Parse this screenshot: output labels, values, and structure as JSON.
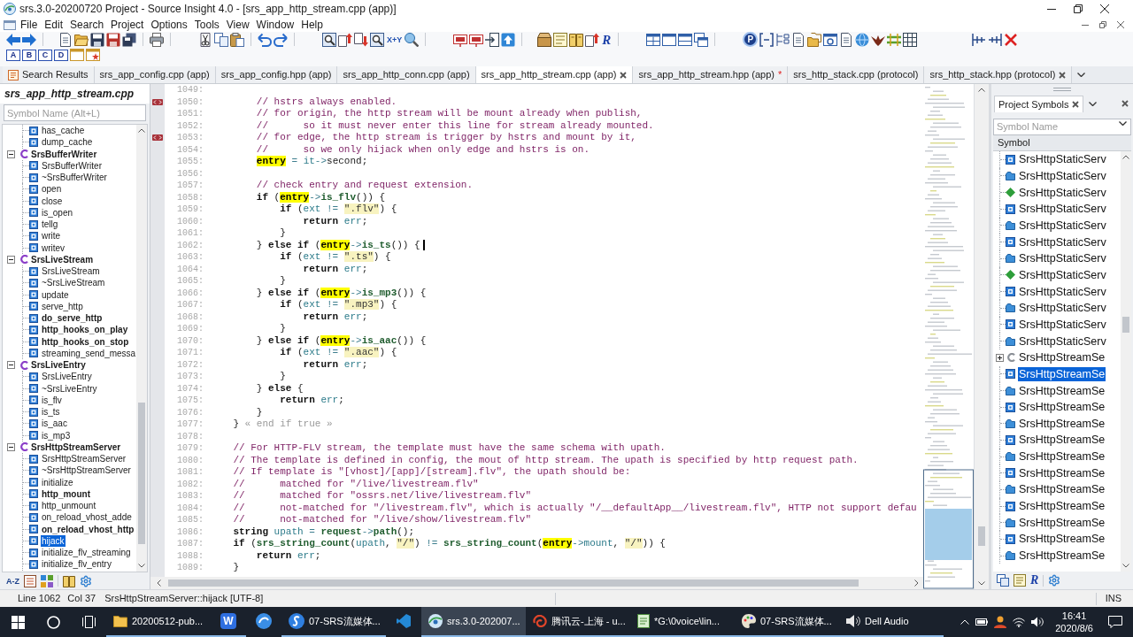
{
  "window": {
    "title": "srs.3.0-20200720 Project - Source Insight 4.0 - [srs_app_http_stream.cpp (app)]"
  },
  "menu": [
    "File",
    "Edit",
    "Search",
    "Project",
    "Options",
    "Tools",
    "View",
    "Window",
    "Help"
  ],
  "toolbar": {
    "icon_labels": [
      {
        "kind": "letters",
        "label": "X+Y"
      },
      {
        "kind": "script",
        "label": "R"
      },
      {
        "kind": "badge",
        "label": "P"
      }
    ],
    "bookmark_keys": [
      "A",
      "B",
      "C",
      "D"
    ]
  },
  "tabs": [
    {
      "label": "Search Results",
      "kind": "results",
      "selected": false,
      "closable": false
    },
    {
      "label": "srs_app_config.cpp (app)",
      "kind": "file",
      "selected": false,
      "closable": false
    },
    {
      "label": "srs_app_config.hpp (app)",
      "kind": "file",
      "selected": false,
      "closable": false
    },
    {
      "label": "srs_app_http_conn.cpp (app)",
      "kind": "file",
      "selected": false,
      "closable": false
    },
    {
      "label": "srs_app_http_stream.cpp (app)",
      "kind": "file",
      "selected": true,
      "closable": true
    },
    {
      "label": "srs_app_http_stream.hpp (app)",
      "kind": "file",
      "selected": false,
      "closable": false,
      "mark": "*"
    },
    {
      "label": "srs_http_stack.cpp (protocol)",
      "kind": "file",
      "selected": false,
      "closable": false
    },
    {
      "label": "srs_http_stack.hpp (protocol)",
      "kind": "file",
      "selected": false,
      "closable": true
    }
  ],
  "symbol_panel": {
    "title": "srs_app_http_stream.cpp",
    "search_placeholder": "Symbol Name (Alt+L)",
    "sort_label": "A-Z",
    "tree": [
      {
        "kind": "group",
        "children": [
          {
            "label": "has_cache",
            "kind": "method",
            "bold": false,
            "selected": false
          },
          {
            "label": "dump_cache",
            "kind": "method",
            "bold": false,
            "selected": false
          }
        ]
      },
      {
        "label": "SrsBufferWriter",
        "kind": "class",
        "bold": true,
        "selected": false,
        "expanded": true,
        "children": [
          {
            "label": "SrsBufferWriter",
            "kind": "method",
            "bold": false,
            "selected": false
          },
          {
            "label": "~SrsBufferWriter",
            "kind": "method",
            "bold": false,
            "selected": false
          },
          {
            "label": "open",
            "kind": "method",
            "bold": false,
            "selected": false
          },
          {
            "label": "close",
            "kind": "method",
            "bold": false,
            "selected": false
          },
          {
            "label": "is_open",
            "kind": "method",
            "bold": false,
            "selected": false
          },
          {
            "label": "tellg",
            "kind": "method",
            "bold": false,
            "selected": false
          },
          {
            "label": "write",
            "kind": "method",
            "bold": false,
            "selected": false
          },
          {
            "label": "writev",
            "kind": "method",
            "bold": false,
            "selected": false
          }
        ]
      },
      {
        "label": "SrsLiveStream",
        "kind": "class",
        "bold": true,
        "selected": false,
        "expanded": true,
        "children": [
          {
            "label": "SrsLiveStream",
            "kind": "method",
            "bold": false,
            "selected": false
          },
          {
            "label": "~SrsLiveStream",
            "kind": "method",
            "bold": false,
            "selected": false
          },
          {
            "label": "update",
            "kind": "method",
            "bold": false,
            "selected": false
          },
          {
            "label": "serve_http",
            "kind": "method",
            "bold": false,
            "selected": false
          },
          {
            "label": "do_serve_http",
            "kind": "method",
            "bold": true,
            "selected": false
          },
          {
            "label": "http_hooks_on_play",
            "kind": "method",
            "bold": true,
            "selected": false
          },
          {
            "label": "http_hooks_on_stop",
            "kind": "method",
            "bold": true,
            "selected": false
          },
          {
            "label": "streaming_send_messa",
            "kind": "method",
            "bold": false,
            "selected": false
          }
        ]
      },
      {
        "label": "SrsLiveEntry",
        "kind": "class",
        "bold": true,
        "selected": false,
        "expanded": true,
        "children": [
          {
            "label": "SrsLiveEntry",
            "kind": "method",
            "bold": false,
            "selected": false
          },
          {
            "label": "~SrsLiveEntry",
            "kind": "method",
            "bold": false,
            "selected": false
          },
          {
            "label": "is_flv",
            "kind": "method",
            "bold": false,
            "selected": false
          },
          {
            "label": "is_ts",
            "kind": "method",
            "bold": false,
            "selected": false
          },
          {
            "label": "is_aac",
            "kind": "method",
            "bold": false,
            "selected": false
          },
          {
            "label": "is_mp3",
            "kind": "method",
            "bold": false,
            "selected": false
          }
        ]
      },
      {
        "label": "SrsHttpStreamServer",
        "kind": "class",
        "bold": true,
        "selected": false,
        "expanded": true,
        "children": [
          {
            "label": "SrsHttpStreamServer",
            "kind": "method",
            "bold": false,
            "selected": false
          },
          {
            "label": "~SrsHttpStreamServer",
            "kind": "method",
            "bold": false,
            "selected": false
          },
          {
            "label": "initialize",
            "kind": "method",
            "bold": false,
            "selected": false
          },
          {
            "label": "http_mount",
            "kind": "method",
            "bold": true,
            "selected": false
          },
          {
            "label": "http_unmount",
            "kind": "method",
            "bold": false,
            "selected": false
          },
          {
            "label": "on_reload_vhost_adde",
            "kind": "method",
            "bold": false,
            "selected": false
          },
          {
            "label": "on_reload_vhost_http",
            "kind": "method",
            "bold": true,
            "selected": false
          },
          {
            "label": "hijack",
            "kind": "method",
            "bold": false,
            "selected": true
          },
          {
            "label": "initialize_flv_streaming",
            "kind": "method",
            "bold": false,
            "selected": false
          },
          {
            "label": "initialize_flv_entry",
            "kind": "method",
            "bold": false,
            "selected": false
          }
        ]
      }
    ]
  },
  "editor": {
    "lines": [
      {
        "number": "1049:",
        "bookmark": false
      },
      {
        "number": "1050:",
        "bookmark": true,
        "tokens": [
          {
            "kind": "comment",
            "text": "        // hstrs always enabled."
          }
        ]
      },
      {
        "number": "1051:",
        "bookmark": false,
        "tokens": [
          {
            "kind": "comment",
            "text": "        // for origin, the http stream will be mount already when publish,"
          }
        ]
      },
      {
        "number": "1052:",
        "bookmark": false,
        "tokens": [
          {
            "kind": "comment",
            "text": "        //      so it must never enter this line for stream already mounted."
          }
        ]
      },
      {
        "number": "1053:",
        "bookmark": true,
        "tokens": [
          {
            "kind": "comment",
            "text": "        // for edge, the http stream is trigger by hstrs and mount by it,"
          }
        ]
      },
      {
        "number": "1054:",
        "bookmark": false,
        "tokens": [
          {
            "kind": "comment",
            "text": "        //      so we only hijack when only edge and hstrs is on."
          }
        ]
      },
      {
        "number": "1055:",
        "bookmark": false,
        "tokens": [
          {
            "kind": "match",
            "text": "        entry"
          },
          {
            "kind": "operator",
            "text": " = "
          },
          {
            "kind": "variable",
            "text": "it"
          },
          {
            "kind": "operator",
            "text": "->"
          },
          {
            "kind": "plain",
            "text": "second;"
          }
        ]
      },
      {
        "number": "1056:",
        "bookmark": false
      },
      {
        "number": "1057:",
        "bookmark": false,
        "tokens": [
          {
            "kind": "comment",
            "text": "        // check entry and request extension."
          }
        ]
      },
      {
        "number": "1058:",
        "bookmark": false,
        "tokens": [
          {
            "kind": "keyword",
            "text": "        if"
          },
          {
            "kind": "plain",
            "text": " ("
          },
          {
            "kind": "match",
            "text": "entry"
          },
          {
            "kind": "operator",
            "text": "->"
          },
          {
            "kind": "function",
            "text": "is_flv"
          },
          {
            "kind": "plain",
            "text": "()) {"
          }
        ]
      },
      {
        "number": "1059:",
        "bookmark": false,
        "tokens": [
          {
            "kind": "keyword",
            "text": "            if"
          },
          {
            "kind": "plain",
            "text": " ("
          },
          {
            "kind": "variable",
            "text": "ext"
          },
          {
            "kind": "operator",
            "text": " != "
          },
          {
            "kind": "string",
            "text": "\".flv\""
          },
          {
            "kind": "plain",
            "text": ") {"
          }
        ]
      },
      {
        "number": "1060:",
        "bookmark": false,
        "tokens": [
          {
            "kind": "keyword",
            "text": "                return "
          },
          {
            "kind": "variable",
            "text": "err"
          },
          {
            "kind": "plain",
            "text": ";"
          }
        ]
      },
      {
        "number": "1061:",
        "bookmark": false,
        "tokens": [
          {
            "kind": "plain",
            "text": "            }"
          }
        ]
      },
      {
        "number": "1062:",
        "bookmark": false,
        "tokens": [
          {
            "kind": "plain",
            "text": "        } "
          },
          {
            "kind": "keyword",
            "text": "else if"
          },
          {
            "kind": "plain",
            "text": " ("
          },
          {
            "kind": "match",
            "text": "entry"
          },
          {
            "kind": "operator",
            "text": "->"
          },
          {
            "kind": "function",
            "text": "is_ts"
          },
          {
            "kind": "plain",
            "text": "()) {"
          },
          {
            "kind": "caret"
          }
        ]
      },
      {
        "number": "1063:",
        "bookmark": false,
        "tokens": [
          {
            "kind": "keyword",
            "text": "            if"
          },
          {
            "kind": "plain",
            "text": " ("
          },
          {
            "kind": "variable",
            "text": "ext"
          },
          {
            "kind": "operator",
            "text": " != "
          },
          {
            "kind": "string",
            "text": "\".ts\""
          },
          {
            "kind": "plain",
            "text": ") {"
          }
        ]
      },
      {
        "number": "1064:",
        "bookmark": false,
        "tokens": [
          {
            "kind": "keyword",
            "text": "                return "
          },
          {
            "kind": "variable",
            "text": "err"
          },
          {
            "kind": "plain",
            "text": ";"
          }
        ]
      },
      {
        "number": "1065:",
        "bookmark": false,
        "tokens": [
          {
            "kind": "plain",
            "text": "            }"
          }
        ]
      },
      {
        "number": "1066:",
        "bookmark": false,
        "tokens": [
          {
            "kind": "plain",
            "text": "        } "
          },
          {
            "kind": "keyword",
            "text": "else if"
          },
          {
            "kind": "plain",
            "text": " ("
          },
          {
            "kind": "match",
            "text": "entry"
          },
          {
            "kind": "operator",
            "text": "->"
          },
          {
            "kind": "function",
            "text": "is_mp3"
          },
          {
            "kind": "plain",
            "text": "()) {"
          }
        ]
      },
      {
        "number": "1067:",
        "bookmark": false,
        "tokens": [
          {
            "kind": "keyword",
            "text": "            if"
          },
          {
            "kind": "plain",
            "text": " ("
          },
          {
            "kind": "variable",
            "text": "ext"
          },
          {
            "kind": "operator",
            "text": " != "
          },
          {
            "kind": "string",
            "text": "\".mp3\""
          },
          {
            "kind": "plain",
            "text": ") {"
          }
        ]
      },
      {
        "number": "1068:",
        "bookmark": false,
        "tokens": [
          {
            "kind": "keyword",
            "text": "                return "
          },
          {
            "kind": "variable",
            "text": "err"
          },
          {
            "kind": "plain",
            "text": ";"
          }
        ]
      },
      {
        "number": "1069:",
        "bookmark": false,
        "tokens": [
          {
            "kind": "plain",
            "text": "            }"
          }
        ]
      },
      {
        "number": "1070:",
        "bookmark": false,
        "tokens": [
          {
            "kind": "plain",
            "text": "        } "
          },
          {
            "kind": "keyword",
            "text": "else if"
          },
          {
            "kind": "plain",
            "text": " ("
          },
          {
            "kind": "match",
            "text": "entry"
          },
          {
            "kind": "operator",
            "text": "->"
          },
          {
            "kind": "function",
            "text": "is_aac"
          },
          {
            "kind": "plain",
            "text": "()) {"
          }
        ]
      },
      {
        "number": "1071:",
        "bookmark": false,
        "tokens": [
          {
            "kind": "keyword",
            "text": "            if"
          },
          {
            "kind": "plain",
            "text": " ("
          },
          {
            "kind": "variable",
            "text": "ext"
          },
          {
            "kind": "operator",
            "text": " != "
          },
          {
            "kind": "string",
            "text": "\".aac\""
          },
          {
            "kind": "plain",
            "text": ") {"
          }
        ]
      },
      {
        "number": "1072:",
        "bookmark": false,
        "tokens": [
          {
            "kind": "keyword",
            "text": "                return "
          },
          {
            "kind": "variable",
            "text": "err"
          },
          {
            "kind": "plain",
            "text": ";"
          }
        ]
      },
      {
        "number": "1073:",
        "bookmark": false,
        "tokens": [
          {
            "kind": "plain",
            "text": "            }"
          }
        ]
      },
      {
        "number": "1074:",
        "bookmark": false,
        "tokens": [
          {
            "kind": "plain",
            "text": "        } "
          },
          {
            "kind": "keyword",
            "text": "else"
          },
          {
            "kind": "plain",
            "text": " {"
          }
        ]
      },
      {
        "number": "1075:",
        "bookmark": false,
        "tokens": [
          {
            "kind": "keyword",
            "text": "            return "
          },
          {
            "kind": "variable",
            "text": "err"
          },
          {
            "kind": "plain",
            "text": ";"
          }
        ]
      },
      {
        "number": "1076:",
        "bookmark": false,
        "tokens": [
          {
            "kind": "plain",
            "text": "        }"
          }
        ]
      },
      {
        "number": "1077:",
        "bookmark": false,
        "tokens": [
          {
            "kind": "plain",
            "text": "    } "
          },
          {
            "kind": "fold_note",
            "text": "« end if true »"
          }
        ]
      },
      {
        "number": "1078:",
        "bookmark": false
      },
      {
        "number": "1079:",
        "bookmark": false,
        "tokens": [
          {
            "kind": "comment",
            "text": "    // For HTTP-FLV stream, the template must have the same schema with upath."
          }
        ]
      },
      {
        "number": "1080:",
        "bookmark": false,
        "tokens": [
          {
            "kind": "comment",
            "text": "    // The template is defined in config, the mout of http stream. The upath is specified by http request path."
          }
        ]
      },
      {
        "number": "1081:",
        "bookmark": false,
        "tokens": [
          {
            "kind": "comment",
            "text": "    // If template is \"[vhost]/[app]/[stream].flv\", the upath should be:"
          }
        ]
      },
      {
        "number": "1082:",
        "bookmark": false,
        "tokens": [
          {
            "kind": "comment",
            "text": "    //      matched for \"/live/livestream.flv\""
          }
        ]
      },
      {
        "number": "1083:",
        "bookmark": false,
        "tokens": [
          {
            "kind": "comment",
            "text": "    //      matched for \"ossrs.net/live/livestream.flv\""
          }
        ]
      },
      {
        "number": "1084:",
        "bookmark": false,
        "tokens": [
          {
            "kind": "comment",
            "text": "    //      not-matched for \"/livestream.flv\", which is actually \"/__defaultApp__/livestream.flv\", HTTP not support defau"
          }
        ]
      },
      {
        "number": "1085:",
        "bookmark": false,
        "tokens": [
          {
            "kind": "comment",
            "text": "    //      not-matched for \"/live/show/livestream.flv\""
          }
        ]
      },
      {
        "number": "1086:",
        "bookmark": false,
        "tokens": [
          {
            "kind": "keyword",
            "text": "    string "
          },
          {
            "kind": "variable",
            "text": "upath"
          },
          {
            "kind": "operator",
            "text": " = "
          },
          {
            "kind": "function",
            "text": "request"
          },
          {
            "kind": "operator",
            "text": "->"
          },
          {
            "kind": "function",
            "text": "path"
          },
          {
            "kind": "plain",
            "text": "();"
          }
        ]
      },
      {
        "number": "1087:",
        "bookmark": false,
        "tokens": [
          {
            "kind": "keyword",
            "text": "    if"
          },
          {
            "kind": "plain",
            "text": " ("
          },
          {
            "kind": "function",
            "text": "srs_string_count"
          },
          {
            "kind": "plain",
            "text": "("
          },
          {
            "kind": "variable",
            "text": "upath"
          },
          {
            "kind": "plain",
            "text": ", "
          },
          {
            "kind": "string",
            "text": "\"/\""
          },
          {
            "kind": "plain",
            "text": ")"
          },
          {
            "kind": "operator",
            "text": " != "
          },
          {
            "kind": "function",
            "text": "srs_string_count"
          },
          {
            "kind": "plain",
            "text": "("
          },
          {
            "kind": "match",
            "text": "entry"
          },
          {
            "kind": "operator",
            "text": "->"
          },
          {
            "kind": "variable",
            "text": "mount"
          },
          {
            "kind": "plain",
            "text": ", "
          },
          {
            "kind": "string",
            "text": "\"/\""
          },
          {
            "kind": "plain",
            "text": ")) {"
          }
        ]
      },
      {
        "number": "1088:",
        "bookmark": false,
        "tokens": [
          {
            "kind": "keyword",
            "text": "        return "
          },
          {
            "kind": "variable",
            "text": "err"
          },
          {
            "kind": "plain",
            "text": ";"
          }
        ]
      },
      {
        "number": "1089:",
        "bookmark": false,
        "tokens": [
          {
            "kind": "plain",
            "text": "    }"
          }
        ]
      }
    ]
  },
  "project_symbols": {
    "tab": "Project Symbols",
    "search_placeholder": "Symbol Name",
    "column": "Symbol",
    "toolbar_label": "R",
    "items": [
      {
        "label": "SrsHttpStaticServ",
        "kind": "method",
        "selected": false
      },
      {
        "label": "SrsHttpStaticServ",
        "kind": "member",
        "selected": false
      },
      {
        "label": "SrsHttpStaticServ",
        "kind": "diamond",
        "selected": false
      },
      {
        "label": "SrsHttpStaticServ",
        "kind": "method",
        "selected": false
      },
      {
        "label": "SrsHttpStaticServ",
        "kind": "member",
        "selected": false
      },
      {
        "label": "SrsHttpStaticServ",
        "kind": "method",
        "selected": false
      },
      {
        "label": "SrsHttpStaticServ",
        "kind": "member",
        "selected": false
      },
      {
        "label": "SrsHttpStaticServ",
        "kind": "diamond",
        "selected": false
      },
      {
        "label": "SrsHttpStaticServ",
        "kind": "method",
        "selected": false
      },
      {
        "label": "SrsHttpStaticServ",
        "kind": "member",
        "selected": false
      },
      {
        "label": "SrsHttpStaticServ",
        "kind": "method",
        "selected": false
      },
      {
        "label": "SrsHttpStaticServ",
        "kind": "member",
        "selected": false
      },
      {
        "label": "SrsHttpStreamSe",
        "kind": "class",
        "selected": false,
        "expanded": false
      },
      {
        "label": "SrsHttpStreamSe",
        "kind": "method",
        "selected": true
      },
      {
        "label": "SrsHttpStreamSe",
        "kind": "member",
        "selected": false
      },
      {
        "label": "SrsHttpStreamSe",
        "kind": "method",
        "selected": false
      },
      {
        "label": "SrsHttpStreamSe",
        "kind": "member",
        "selected": false
      },
      {
        "label": "SrsHttpStreamSe",
        "kind": "method",
        "selected": false
      },
      {
        "label": "SrsHttpStreamSe",
        "kind": "member",
        "selected": false
      },
      {
        "label": "SrsHttpStreamSe",
        "kind": "method",
        "selected": false
      },
      {
        "label": "SrsHttpStreamSe",
        "kind": "member",
        "selected": false
      },
      {
        "label": "SrsHttpStreamSe",
        "kind": "method",
        "selected": false
      },
      {
        "label": "SrsHttpStreamSe",
        "kind": "member",
        "selected": false
      },
      {
        "label": "SrsHttpStreamSe",
        "kind": "method",
        "selected": false
      },
      {
        "label": "SrsHttpStreamSe",
        "kind": "member",
        "selected": false
      }
    ]
  },
  "status_bar": {
    "line": "Line 1062",
    "column": "Col 37",
    "symbol": "SrsHttpStreamServer::hijack [UTF-8]",
    "mode": "INS"
  },
  "taskbar": {
    "apps": [
      {
        "kind": "folder",
        "label": "20200512-pub...",
        "active": false,
        "running": true
      },
      {
        "kind": "writer",
        "glyph": "W",
        "active": false,
        "running": true
      },
      {
        "kind": "browser",
        "active": false,
        "running": false
      },
      {
        "kind": "chat",
        "label": "07-SRS流媒体...",
        "active": false,
        "running": true
      },
      {
        "kind": "editor",
        "active": false,
        "running": false
      },
      {
        "kind": "insight",
        "label": "srs.3.0-202007...",
        "active": true,
        "running": true
      },
      {
        "kind": "cloud",
        "label": "腾讯云-上海 - u...",
        "active": false,
        "running": true
      },
      {
        "kind": "notepad",
        "label": "*G:\\0voice\\lin...",
        "active": false,
        "running": true
      },
      {
        "kind": "paint",
        "label": "07-SRS流媒体...",
        "active": false,
        "running": true
      },
      {
        "kind": "audio",
        "label": "Dell Audio",
        "active": false,
        "running": true
      }
    ],
    "time": "16:41",
    "date": "2020/8/6"
  }
}
